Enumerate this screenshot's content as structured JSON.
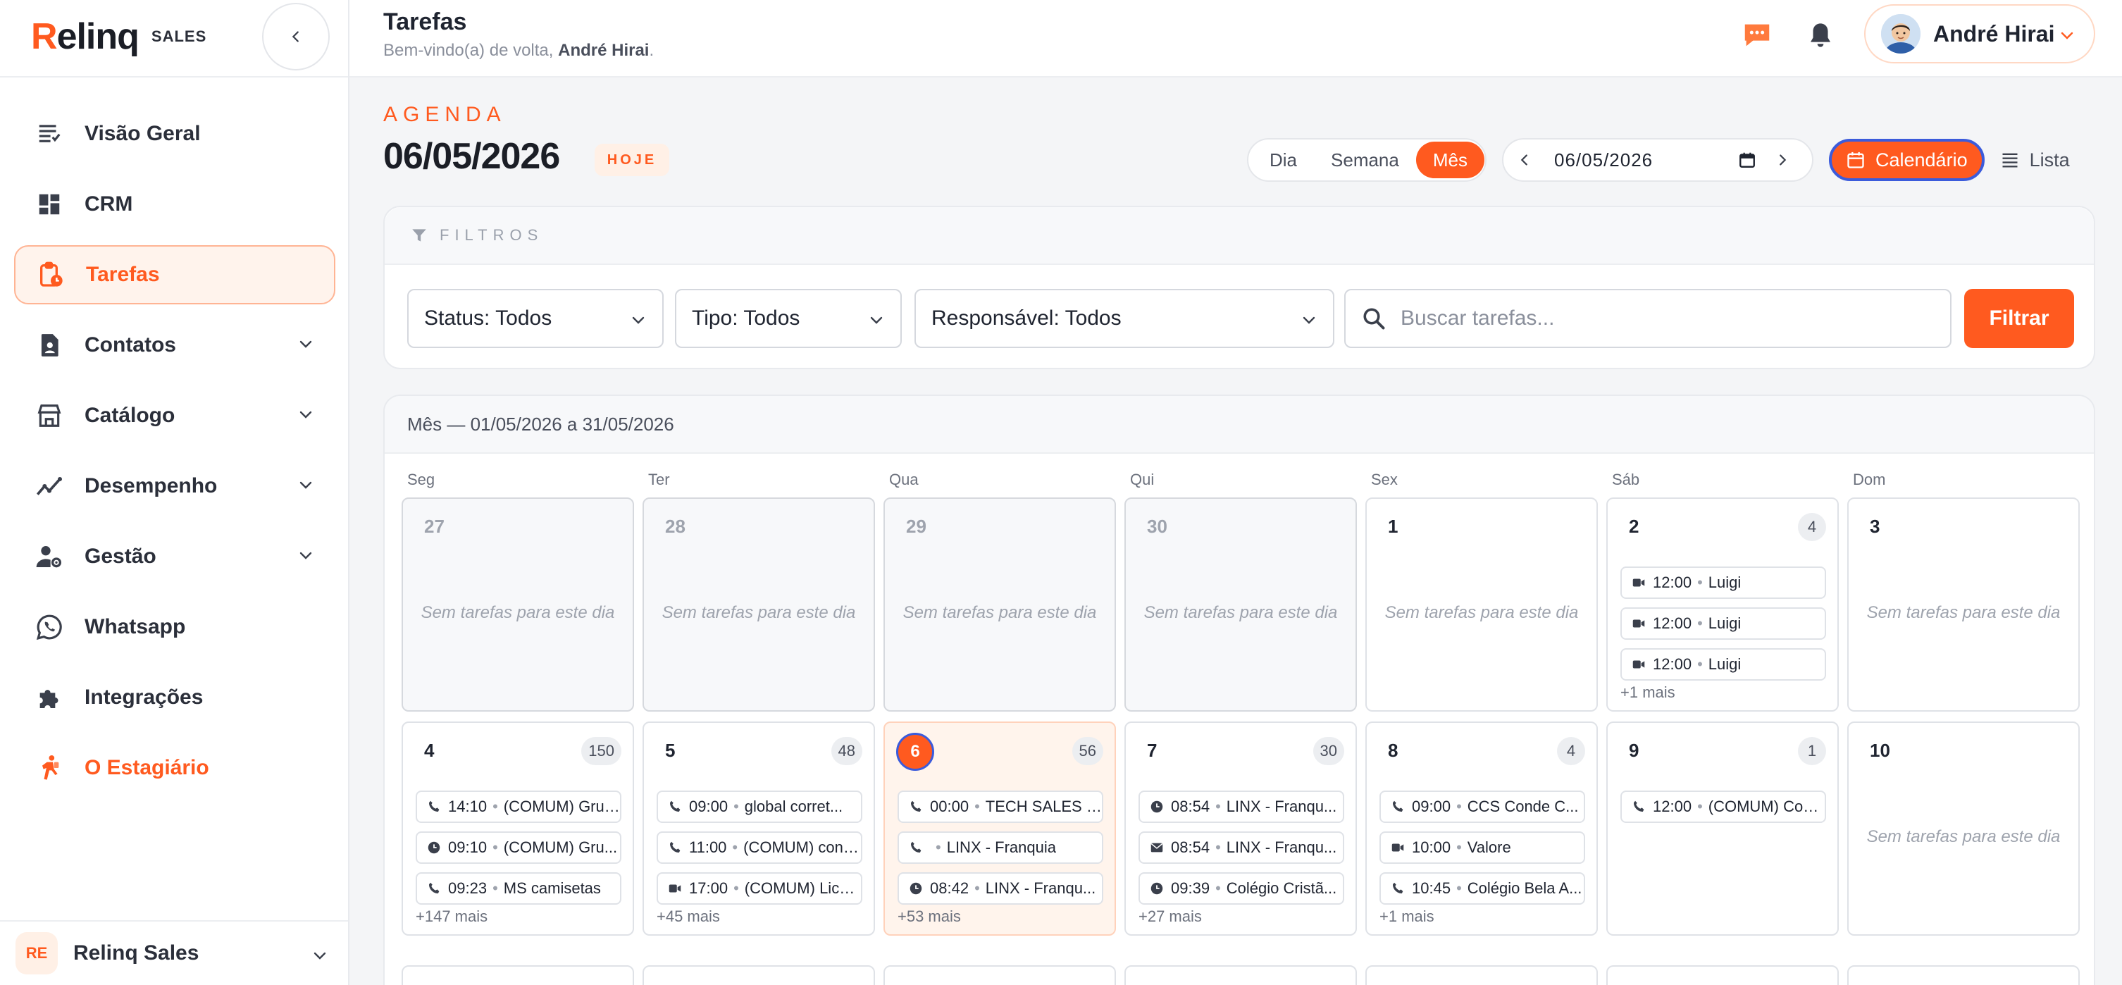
{
  "brand": {
    "name_prefix": "R",
    "name_rest": "elinq",
    "sub": "SALES"
  },
  "sidebar": {
    "items": [
      {
        "label": "Visão Geral",
        "icon": "list-icon"
      },
      {
        "label": "CRM",
        "icon": "dashboard-icon"
      },
      {
        "label": "Tarefas",
        "icon": "clipboard-clock-icon"
      },
      {
        "label": "Contatos",
        "icon": "contact-icon"
      },
      {
        "label": "Catálogo",
        "icon": "store-icon"
      },
      {
        "label": "Desempenho",
        "icon": "trend-icon"
      },
      {
        "label": "Gestão",
        "icon": "user-gear-icon"
      },
      {
        "label": "Whatsapp",
        "icon": "whatsapp-icon"
      },
      {
        "label": "Integrações",
        "icon": "puzzle-icon"
      },
      {
        "label": "O Estagiário",
        "icon": "intern-icon"
      }
    ],
    "org": {
      "badge": "RE",
      "name": "Relinq Sales"
    }
  },
  "header": {
    "title": "Tarefas",
    "welcome_prefix": "Bem-vindo(a) de volta, ",
    "welcome_name": "André Hirai",
    "welcome_suffix": ".",
    "user_name": "André Hirai"
  },
  "agenda": {
    "kicker": "AGENDA",
    "date": "06/05/2026",
    "today_badge": "HOJE",
    "views": [
      "Dia",
      "Semana",
      "Mês"
    ],
    "date_input": "06/05/2026",
    "mode_calendar": "Calendário",
    "mode_list": "Lista"
  },
  "filters": {
    "title": "FILTROS",
    "status": "Status: Todos",
    "type": "Tipo: Todos",
    "owner": "Responsável: Todos",
    "search_placeholder": "Buscar tarefas...",
    "button": "Filtrar"
  },
  "calendar": {
    "range": "Mês — 01/05/2026 a 31/05/2026",
    "weekdays": [
      "Seg",
      "Ter",
      "Qua",
      "Qui",
      "Sex",
      "Sáb",
      "Dom"
    ],
    "empty_text": "Sem tarefas para este dia",
    "week1": [
      {
        "day": "27",
        "past": true
      },
      {
        "day": "28",
        "past": true
      },
      {
        "day": "29",
        "past": true
      },
      {
        "day": "30",
        "past": true
      },
      {
        "day": "1"
      },
      {
        "day": "2",
        "count": "4",
        "tasks": [
          {
            "icon": "video-icon",
            "time": "12:00",
            "title": "Luigi"
          },
          {
            "icon": "video-icon",
            "time": "12:00",
            "title": "Luigi"
          },
          {
            "icon": "video-icon",
            "time": "12:00",
            "title": "Luigi"
          }
        ],
        "more": "+1 mais"
      },
      {
        "day": "3"
      }
    ],
    "week2": [
      {
        "day": "4",
        "count": "150",
        "tasks": [
          {
            "icon": "phone-icon",
            "time": "14:10",
            "title": "(COMUM) Grupo..."
          },
          {
            "icon": "clock-icon",
            "time": "09:10",
            "title": "(COMUM) Gru..."
          },
          {
            "icon": "phone-icon",
            "time": "09:23",
            "title": "MS camisetas"
          }
        ],
        "more": "+147 mais"
      },
      {
        "day": "5",
        "count": "48",
        "tasks": [
          {
            "icon": "phone-icon",
            "time": "09:00",
            "title": "global corret..."
          },
          {
            "icon": "phone-icon",
            "time": "11:00",
            "title": "(COMUM) cone..."
          },
          {
            "icon": "video-icon",
            "time": "17:00",
            "title": "(COMUM) Licen..."
          }
        ],
        "more": "+45 mais"
      },
      {
        "day": "6",
        "count": "56",
        "today": true,
        "tasks": [
          {
            "icon": "phone-icon",
            "time": "00:00",
            "title": "TECH SALES M..."
          },
          {
            "icon": "phone-icon",
            "time": "",
            "title": "LINX - Franquia"
          },
          {
            "icon": "clock-icon",
            "time": "08:42",
            "title": "LINX - Franqu..."
          }
        ],
        "more": "+53 mais"
      },
      {
        "day": "7",
        "count": "30",
        "tasks": [
          {
            "icon": "clock-icon",
            "time": "08:54",
            "title": "LINX - Franqu..."
          },
          {
            "icon": "mail-icon",
            "time": "08:54",
            "title": "LINX - Franqu..."
          },
          {
            "icon": "clock-icon",
            "time": "09:39",
            "title": "Colégio Cristã..."
          }
        ],
        "more": "+27 mais"
      },
      {
        "day": "8",
        "count": "4",
        "tasks": [
          {
            "icon": "phone-icon",
            "time": "09:00",
            "title": "CCS Conde C..."
          },
          {
            "icon": "video-icon",
            "time": "10:00",
            "title": "Valore"
          },
          {
            "icon": "phone-icon",
            "time": "10:45",
            "title": "Colégio Bela A..."
          }
        ],
        "more": "+1 mais"
      },
      {
        "day": "9",
        "count": "1",
        "tasks": [
          {
            "icon": "phone-icon",
            "time": "12:00",
            "title": "(COMUM) Cons..."
          }
        ]
      },
      {
        "day": "10"
      }
    ]
  },
  "colors": {
    "accent": "#ff5a1f",
    "focus_ring": "#3b5bdb"
  }
}
